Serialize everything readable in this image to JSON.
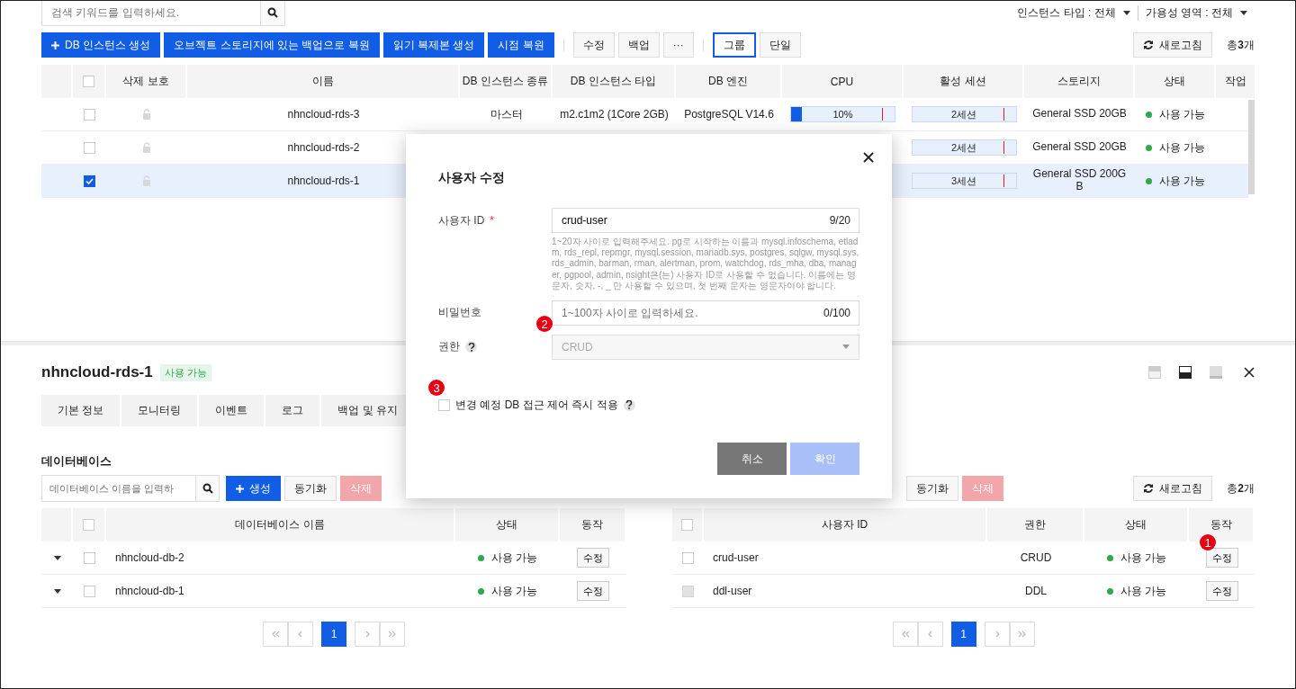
{
  "search": {
    "placeholder": "검색 키워드를 입력하세요."
  },
  "filters": [
    {
      "label": "인스턴스 타입 : 전체"
    },
    {
      "label": "가용성 영역 : 전체"
    }
  ],
  "toolbar": {
    "primary": [
      {
        "label": "DB 인스턴스 생성",
        "kind": "create"
      },
      {
        "label": "오브젝트 스토리지에 있는 백업으로 복원",
        "kind": "plain"
      },
      {
        "label": "읽기 복제본 생성",
        "kind": "plain"
      },
      {
        "label": "시점 복원",
        "kind": "plain"
      }
    ],
    "secondary": [
      "수정",
      "백업",
      "···"
    ],
    "views": [
      {
        "label": "그룹",
        "selected": true
      },
      {
        "label": "단일",
        "selected": false
      }
    ],
    "refresh": "새로고침",
    "total": "총**3**개"
  },
  "instances": {
    "all_checked": false,
    "columns": [
      "삭제 보호",
      "이름",
      "DB 인스턴스 종류",
      "DB 인스턴스 타입",
      "DB 엔진",
      "CPU",
      "활성 세션",
      "스토리지",
      "상태",
      "작업"
    ],
    "rows": [
      {
        "checked": false,
        "selected": false,
        "name": "nhncloud-rds-3",
        "role": "마스터",
        "type": "m2.c1m2 (1Core 2GB)",
        "engine": "PostgreSQL V14.6",
        "cpu": {
          "level": 0.1,
          "reading": "10%"
        },
        "sessions": "2세션",
        "storage": "General SSD 20GB",
        "status": "사용 가능"
      },
      {
        "checked": false,
        "selected": false,
        "name": "nhncloud-rds-2",
        "sessions": "2세션",
        "storage": "General SSD 20GB",
        "status": "사용 가능"
      },
      {
        "checked": true,
        "selected": true,
        "name": "nhncloud-rds-1",
        "sessions": "3세션",
        "storage": "General SSD 200GB",
        "status": "사용 가능"
      }
    ]
  },
  "detail": {
    "title": "nhncloud-rds-1",
    "badge": "사용 가능",
    "tabs": [
      {
        "label": "기본 정보",
        "selected": false
      },
      {
        "label": "모니터링",
        "selected": false
      },
      {
        "label": "이벤트",
        "selected": false
      },
      {
        "label": "로그",
        "selected": false
      },
      {
        "label": "백업 및 유지",
        "selected": false
      }
    ],
    "section": "데이터베이스",
    "databases": {
      "search": {
        "placeholder": "데이터베이스 이름을 입력하"
      },
      "create": "생성",
      "sync": "동기화",
      "delete": {
        "label": "삭제",
        "disabled": true
      },
      "all_checked": false,
      "columns": [
        "데이터베이스 이름",
        "상태",
        "동작"
      ],
      "rows": [
        {
          "name": "nhncloud-db-2",
          "checked": false,
          "status": "사용 가능",
          "action": "수정"
        },
        {
          "name": "nhncloud-db-1",
          "checked": false,
          "status": "사용 가능",
          "action": "수정"
        }
      ],
      "pages": [
        {
          "label": "1",
          "selected": true
        }
      ]
    },
    "users": {
      "sync": "동기화",
      "delete": {
        "label": "삭제",
        "disabled": true
      },
      "refresh": "새로고침",
      "total": "총**2**개",
      "all_checked": false,
      "columns": [
        "사용자 ID",
        "권한",
        "상태",
        "동작"
      ],
      "rows": [
        {
          "name": "crud-user",
          "checked": false,
          "disabled": false,
          "permission": "CRUD",
          "status": "사용 가능",
          "action": "수정"
        },
        {
          "name": "ddl-user",
          "checked": false,
          "disabled": true,
          "permission": "DDL",
          "status": "사용 가능",
          "action": "수정"
        }
      ],
      "pages": [
        {
          "label": "1",
          "selected": true
        }
      ]
    }
  },
  "dialog": {
    "title": "사용자 수정",
    "user_id": {
      "label": "사용자 ID",
      "required_mark": "*",
      "value": "crud-user",
      "counter": "9/20",
      "help": "1~20자 사이로 입력해주세요. pg로 시작하는 이름과 mysql.infoschema, etladm, rds_repl, repmgr, mysql.session, mariadb.sys, postgres, sqlgw, mysql.sys, rds_admin, barman, rman, alertman, prom, watchdog, rds_mha, dba, manager, pgpool, admin, nsight은(는) 사용자 ID로 사용할 수 없습니다. 이름에는 영문자, 숫자, -, _ 만 사용할 수 있으며, 첫 번째 문자는 영문자여야 합니다."
    },
    "password": {
      "label": "비밀번호",
      "placeholder": "1~100자 사이로 입력하세요.",
      "counter": "0/100"
    },
    "permission": {
      "label": "권한",
      "value": "CRUD",
      "disabled": true
    },
    "apply_now": {
      "label": "변경 예정 DB 접근 제어 즉시 적용",
      "checked": false
    },
    "cancel": "취소",
    "confirm": {
      "label": "확인",
      "disabled": true
    }
  },
  "annotations": [
    {
      "number": "1"
    },
    {
      "number": "2"
    },
    {
      "number": "3"
    }
  ]
}
